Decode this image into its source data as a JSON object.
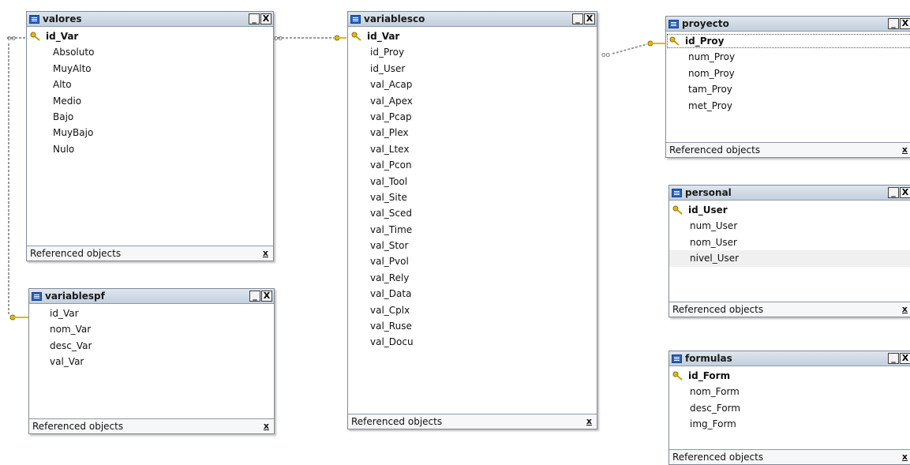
{
  "footer_label": "Referenced objects",
  "window_buttons": {
    "minimize": "_",
    "close": "X"
  },
  "footer_button": "x",
  "tables": {
    "valores": {
      "name": "valores",
      "fields": [
        "id_Var",
        "Absoluto",
        "MuyAlto",
        "Alto",
        "Medio",
        "Bajo",
        "MuyBajo",
        "Nulo"
      ]
    },
    "variablespf": {
      "name": "variablespf",
      "fields": [
        "id_Var",
        "nom_Var",
        "desc_Var",
        "val_Var"
      ]
    },
    "variablesco": {
      "name": "variablesco",
      "fields": [
        "id_Var",
        "id_Proy",
        "id_User",
        "val_Acap",
        "val_Apex",
        "val_Pcap",
        "val_Plex",
        "val_Ltex",
        "val_Pcon",
        "val_Tool",
        "val_Site",
        "val_Sced",
        "val_Time",
        "val_Stor",
        "val_Pvol",
        "val_Rely",
        "val_Data",
        "val_Cplx",
        "val_Ruse",
        "val_Docu"
      ]
    },
    "proyecto": {
      "name": "proyecto",
      "fields": [
        "id_Proy",
        "num_Proy",
        "nom_Proy",
        "tam_Proy",
        "met_Proy"
      ]
    },
    "personal": {
      "name": "personal",
      "fields": [
        "id_User",
        "num_User",
        "nom_User",
        "nivel_User"
      ]
    },
    "formulas": {
      "name": "formulas",
      "fields": [
        "id_Form",
        "nom_Form",
        "desc_Form",
        "img_Form"
      ]
    }
  },
  "colors": {
    "title_bar": "#c8d3e1",
    "key_icon": "#e0b821",
    "link_line": "#9a9a9a"
  }
}
